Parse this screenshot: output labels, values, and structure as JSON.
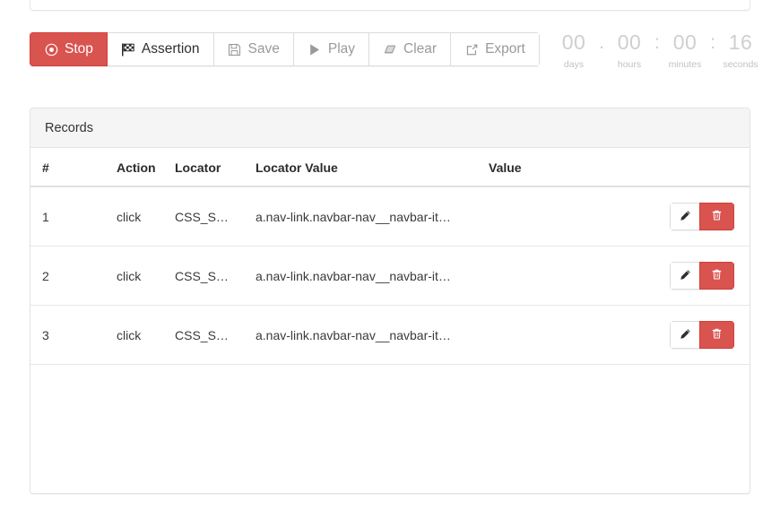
{
  "top_card_stub": {
    "visible": true
  },
  "toolbar": {
    "buttons": [
      {
        "label": "Stop",
        "icon": "stop-record-icon",
        "state": "active",
        "icon_name": "record-circle-icon"
      },
      {
        "label": "Assertion",
        "icon": "checkered-flag-icon",
        "state": "enabled",
        "icon_name": "checkered-flag-icon"
      },
      {
        "label": "Save",
        "icon": "floppy-disk-icon",
        "state": "disabled",
        "icon_name": "floppy-disk-icon"
      },
      {
        "label": "Play",
        "icon": "play-triangle-icon",
        "state": "disabled",
        "icon_name": "play-triangle-icon"
      },
      {
        "label": "Clear",
        "icon": "eraser-icon",
        "state": "disabled",
        "icon_name": "eraser-icon"
      },
      {
        "label": "Export",
        "icon": "export-share-icon",
        "state": "disabled",
        "icon_name": "export-share-icon"
      }
    ]
  },
  "timer": {
    "days": {
      "value": "00",
      "label": "days"
    },
    "hours": {
      "value": "00",
      "label": "hours"
    },
    "minutes": {
      "value": "00",
      "label": "minutes"
    },
    "seconds": {
      "value": "16",
      "label": "seconds"
    },
    "sep1": ".",
    "sep2": ":",
    "sep3": ":"
  },
  "records": {
    "title": "Records",
    "columns": [
      "#",
      "Action",
      "Locator",
      "Locator Value",
      "Value"
    ],
    "rows": [
      {
        "index": "1",
        "action": "click",
        "locator": "CSS_S…",
        "locator_value": "a.nav-link.navbar-nav__navbar-it…",
        "value": ""
      },
      {
        "index": "2",
        "action": "click",
        "locator": "CSS_S…",
        "locator_value": "a.nav-link.navbar-nav__navbar-it…",
        "value": ""
      },
      {
        "index": "3",
        "action": "click",
        "locator": "CSS_S…",
        "locator_value": "a.nav-link.navbar-nav__navbar-it…",
        "value": ""
      }
    ],
    "row_actions": {
      "edit": "edit-pencil-icon",
      "delete": "delete-trash-icon"
    }
  },
  "colors": {
    "danger": "#d9534f",
    "card_header_bg": "#f5f5f5",
    "border": "#e3e3e3",
    "muted_text": "#9a9a9a",
    "timer_text": "#cfcfcf"
  }
}
